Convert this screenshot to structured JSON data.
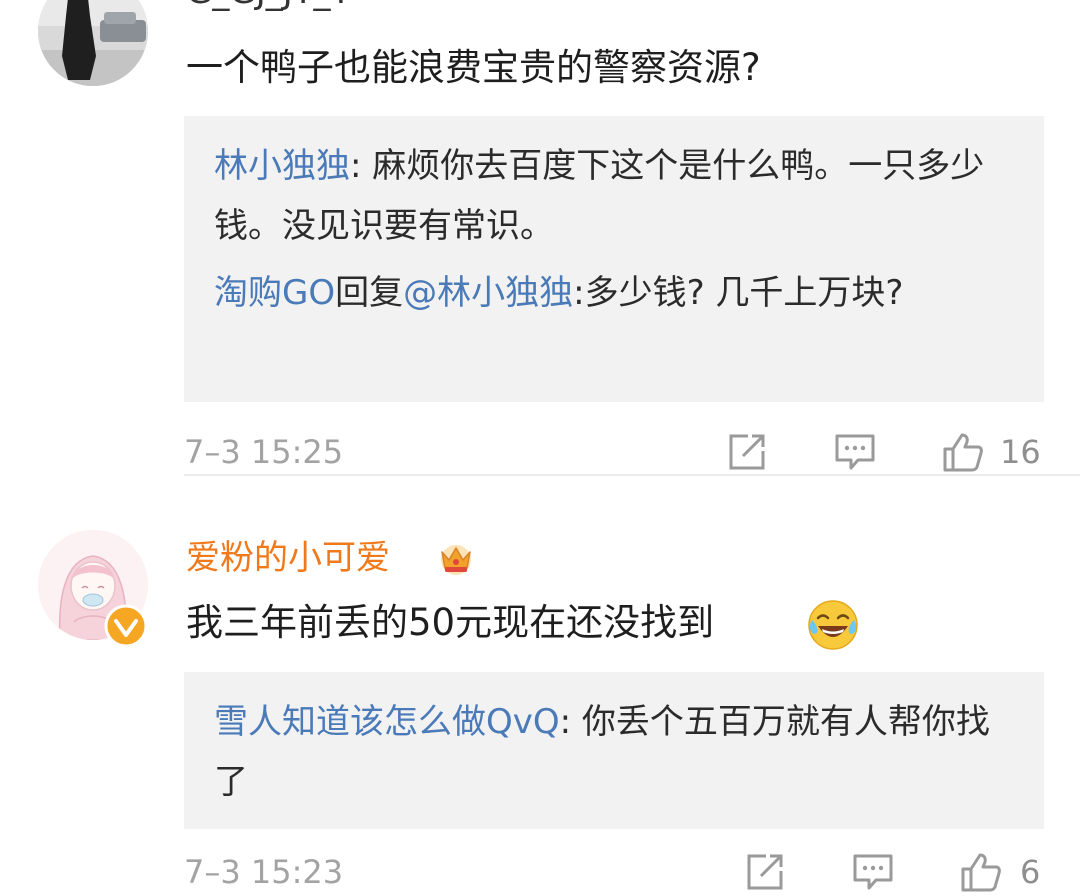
{
  "comments": [
    {
      "username": "G_GJ_JY_Y",
      "text": "一个鸭子也能浪费宝贵的警察资源?",
      "replies": [
        {
          "name": "林小独独",
          "separator": ": ",
          "text": "麻烦你去百度下这个是什么鸭。一只多少钱。没见识要有常识。"
        },
        {
          "name": "淘购GO",
          "mid": "回复",
          "mention": "@林小独独",
          "separator": ":",
          "text": "多少钱? 几千上万块?"
        }
      ],
      "time": "7–3 15:25",
      "likes": "16"
    },
    {
      "username": "爱粉的小可爱",
      "badge": "crown-icon",
      "verified": "verified-badge-icon",
      "text": "我三年前丢的50元现在还没找到",
      "emoji": "laughing-crying-emoji",
      "replies": [
        {
          "name": "雪人知道该怎么做QvQ",
          "separator": ": ",
          "text": "你丢个五百万就有人帮你找了"
        }
      ],
      "time": "7–3 15:23",
      "likes": "6"
    }
  ],
  "colors": {
    "reply_name": "#4a7ab8",
    "vip_username": "#f07a1b",
    "reply_box_bg": "#f2f2f2",
    "meta_text": "#a3a3a3"
  }
}
